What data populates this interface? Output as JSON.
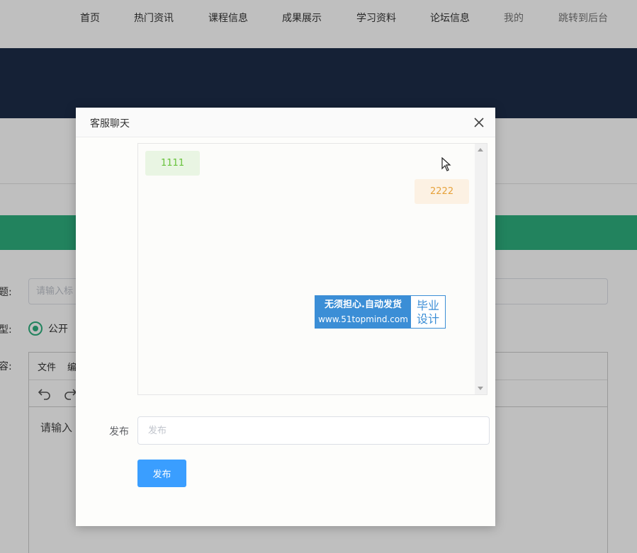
{
  "nav": {
    "items": [
      {
        "label": "首页"
      },
      {
        "label": "热门资讯"
      },
      {
        "label": "课程信息"
      },
      {
        "label": "成果展示"
      },
      {
        "label": "学习资料"
      },
      {
        "label": "论坛信息"
      },
      {
        "label": "我的"
      },
      {
        "label": "跳转到后台"
      }
    ]
  },
  "form": {
    "title_label": "题:",
    "title_placeholder": "请输入标",
    "type_label": "型:",
    "type_option": "公开",
    "content_label": "容:",
    "editor_menu": [
      "文件",
      "编"
    ],
    "editor_placeholder": "请输入"
  },
  "dialog": {
    "title": "客服聊天",
    "close_icon": "close-icon",
    "messages": [
      {
        "text": "1111",
        "side": "left"
      },
      {
        "text": "2222",
        "side": "right"
      }
    ],
    "watermark": {
      "line1": "无须担心.自动发货",
      "line2": "www.51topmind.com",
      "badge_line1": "毕业",
      "badge_line2": "设计"
    },
    "publish_label": "发布",
    "publish_placeholder": "发布",
    "publish_button": "发布"
  },
  "colors": {
    "accent_green": "#2eaf7e",
    "banner_navy": "#1c2c48",
    "button_blue": "#3a9eff",
    "msg_left_text": "#67c23a",
    "msg_right_text": "#e6a23c"
  }
}
